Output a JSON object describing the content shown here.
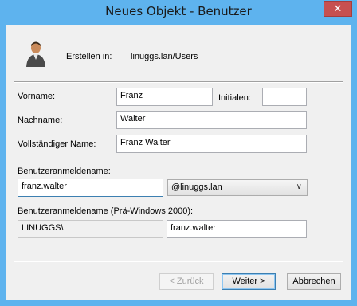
{
  "window": {
    "title": "Neues Objekt - Benutzer",
    "close_glyph": "✕"
  },
  "header": {
    "create_in_label": "Erstellen in:",
    "create_in_value": "linuggs.lan/Users",
    "icon": "user-icon"
  },
  "form": {
    "first_name_label": "Vorname:",
    "first_name_value": "Franz",
    "initials_label": "Initialen:",
    "initials_value": "",
    "last_name_label": "Nachname:",
    "last_name_value": "Walter",
    "full_name_label": "Vollständiger Name:",
    "full_name_value": "Franz Walter",
    "logon_name_label": "Benutzeranmeldename:",
    "logon_name_value": "franz.walter",
    "domain_selected": "@linuggs.lan",
    "prewin_label": "Benutzeranmeldename (Prä-Windows 2000):",
    "prewin_domain": "LINUGGS\\",
    "prewin_user": "franz.walter"
  },
  "buttons": {
    "back": "< Zurück",
    "next": "Weiter >",
    "cancel": "Abbrechen"
  },
  "colors": {
    "titlebar": "#5eb3ee",
    "close": "#c75050",
    "client": "#f0f0f0"
  }
}
